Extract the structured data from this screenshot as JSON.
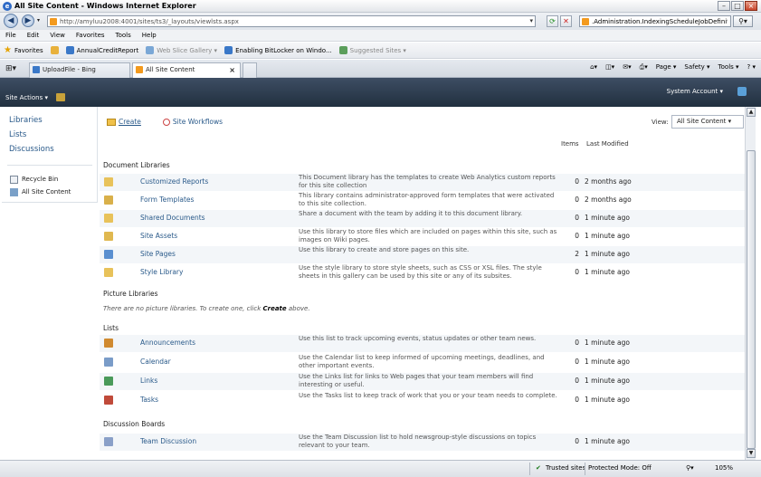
{
  "window": {
    "title": "All Site Content - Windows Internet Explorer"
  },
  "address": {
    "url": "http://amyluu2008:4001/sites/ts3/_layouts/viewlsts.aspx"
  },
  "search": {
    "value": ".Administration.IndexingScheduleJobDefinition\""
  },
  "menu": [
    "File",
    "Edit",
    "View",
    "Favorites",
    "Tools",
    "Help"
  ],
  "favorites": {
    "label": "Favorites",
    "items": [
      {
        "label": "AnnualCreditReport",
        "dim": false
      },
      {
        "label": "Web Slice Gallery ▾",
        "dim": true
      },
      {
        "label": "Enabling BitLocker on Windo...",
        "dim": false
      },
      {
        "label": "Suggested Sites ▾",
        "dim": true
      }
    ]
  },
  "tabs": [
    {
      "label": "UploadFile - Bing",
      "active": false
    },
    {
      "label": "All Site Content",
      "active": true
    }
  ],
  "tools": {
    "page": "Page ▾",
    "safety": "Safety ▾",
    "tools": "Tools ▾",
    "help": "? ▾"
  },
  "sp": {
    "site_actions": "Site Actions ▾",
    "account": "System Account ▾"
  },
  "leftnav": {
    "libraries": "Libraries",
    "lists": "Lists",
    "discussions": "Discussions",
    "recycle": "Recycle Bin",
    "all_content": "All Site Content"
  },
  "actions": {
    "create": "Create",
    "workflows": "Site Workflows"
  },
  "view": {
    "label": "View:",
    "selected": "All Site Content ▾"
  },
  "columns": {
    "items": "Items",
    "modified": "Last Modified"
  },
  "sections": {
    "doclibs": "Document Libraries",
    "piclibs": "Picture Libraries",
    "lists": "Lists",
    "boards": "Discussion Boards"
  },
  "nopic": {
    "pre": "There are no picture libraries. To create one, click ",
    "link": "Create",
    "post": " above."
  },
  "doc_rows": [
    {
      "name": "Customized Reports",
      "desc": "This Document library has the templates to create Web Analytics custom reports for this site collection",
      "count": "0",
      "modified": "2 months ago"
    },
    {
      "name": "Form Templates",
      "desc": "This library contains administrator-approved form templates that were activated to this site collection.",
      "count": "0",
      "modified": "2 months ago"
    },
    {
      "name": "Shared Documents",
      "desc": "Share a document with the team by adding it to this document library.",
      "count": "0",
      "modified": "1 minute ago"
    },
    {
      "name": "Site Assets",
      "desc": "Use this library to store files which are included on pages within this site, such as images on Wiki pages.",
      "count": "0",
      "modified": "1 minute ago"
    },
    {
      "name": "Site Pages",
      "desc": "Use this library to create and store pages on this site.",
      "count": "2",
      "modified": "1 minute ago"
    },
    {
      "name": "Style Library",
      "desc": "Use the style library to store style sheets, such as CSS or XSL files. The style sheets in this gallery can be used by this site or any of its subsites.",
      "count": "0",
      "modified": "1 minute ago"
    }
  ],
  "list_rows": [
    {
      "name": "Announcements",
      "desc": "Use this list to track upcoming events, status updates or other team news.",
      "count": "0",
      "modified": "1 minute ago"
    },
    {
      "name": "Calendar",
      "desc": "Use the Calendar list to keep informed of upcoming meetings, deadlines, and other important events.",
      "count": "0",
      "modified": "1 minute ago"
    },
    {
      "name": "Links",
      "desc": "Use the Links list for links to Web pages that your team members will find interesting or useful.",
      "count": "0",
      "modified": "1 minute ago"
    },
    {
      "name": "Tasks",
      "desc": "Use the Tasks list to keep track of work that you or your team needs to complete.",
      "count": "0",
      "modified": "1 minute ago"
    }
  ],
  "board_rows": [
    {
      "name": "Team Discussion",
      "desc": "Use the Team Discussion list to hold newsgroup-style discussions on topics relevant to your team.",
      "count": "0",
      "modified": "1 minute ago"
    }
  ],
  "status": {
    "trusted": "Trusted sites",
    "protected": "Protected Mode: Off",
    "zoom": "105%"
  },
  "colors": {
    "link": "#2a5a8a",
    "sp_bar": "#2b3a4c",
    "row_shade": "#f3f6f9"
  }
}
